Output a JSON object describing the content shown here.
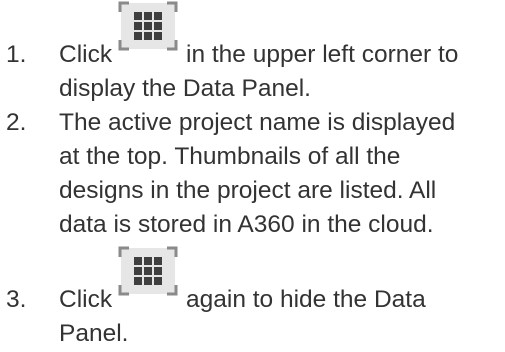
{
  "instructions": {
    "step1": {
      "number": "1.",
      "prefix": "Click",
      "suffix": "in the upper left corner to",
      "line2": "display the Data Panel.",
      "icon": "data-panel-grid-icon"
    },
    "step2": {
      "number": "2.",
      "lines": [
        "The active project name is displayed",
        "at the top. Thumbnails of all the",
        "designs in the project are listed. All",
        "data is stored in A360 in the cloud."
      ]
    },
    "step3": {
      "number": "3.",
      "prefix": "Click",
      "suffix": "again to hide the Data",
      "line2": "Panel.",
      "icon": "data-panel-grid-icon"
    }
  },
  "colors": {
    "text": "#333333",
    "icon_fill": "#3f3f3f",
    "icon_bg": "#e6e6e6",
    "icon_border": "#8a8a8a"
  }
}
